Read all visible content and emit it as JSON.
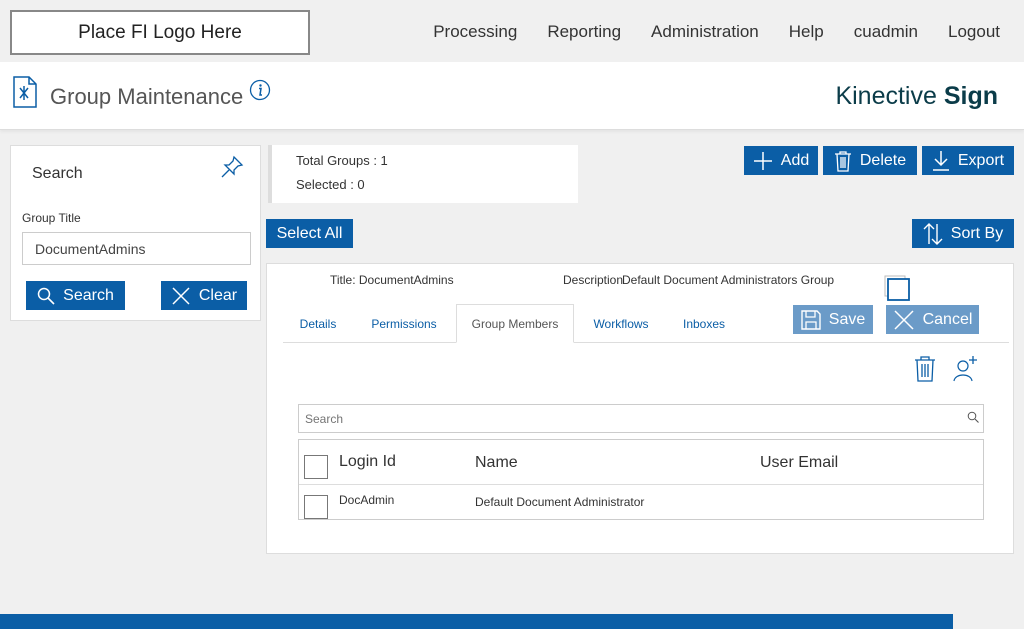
{
  "logo": {
    "text": "Place FI Logo Here"
  },
  "nav": [
    {
      "label": "Processing"
    },
    {
      "label": "Reporting"
    },
    {
      "label": "Administration"
    },
    {
      "label": "Help"
    },
    {
      "label": "cuadmin"
    },
    {
      "label": "Logout"
    }
  ],
  "header": {
    "title": "Group Maintenance",
    "brand_light": "Kinective ",
    "brand_bold": "Sign"
  },
  "search_panel": {
    "title": "Search",
    "group_title_label": "Group Title",
    "group_title_value": "DocumentAdmins",
    "search_label": "Search",
    "clear_label": "Clear"
  },
  "totals": {
    "total_groups": "Total Groups : 1",
    "selected": "Selected : 0"
  },
  "toolbar": {
    "add_label": "Add",
    "delete_label": "Delete",
    "export_label": "Export",
    "select_all_label": "Select All",
    "sort_by_label": "Sort By"
  },
  "group": {
    "title": "Title: DocumentAdmins",
    "description_label": "Description",
    "description_value": "Default Document Administrators Group",
    "tabs": [
      {
        "label": "Details"
      },
      {
        "label": "Permissions"
      },
      {
        "label": "Group Members"
      },
      {
        "label": "Workflows"
      },
      {
        "label": "Inboxes"
      }
    ],
    "active_tab": "Group Members",
    "save_label": "Save",
    "cancel_label": "Cancel",
    "member_search_placeholder": "Search",
    "columns": [
      {
        "label": "Login Id"
      },
      {
        "label": "Name"
      },
      {
        "label": "User Email"
      }
    ],
    "rows": [
      {
        "login_id": "DocAdmin",
        "name": "Default Document Administrator",
        "email": ""
      }
    ]
  },
  "colors": {
    "primary": "#0b5ea6",
    "disabled_primary": "#6b9bc8",
    "brand_text": "#0b3c49"
  }
}
